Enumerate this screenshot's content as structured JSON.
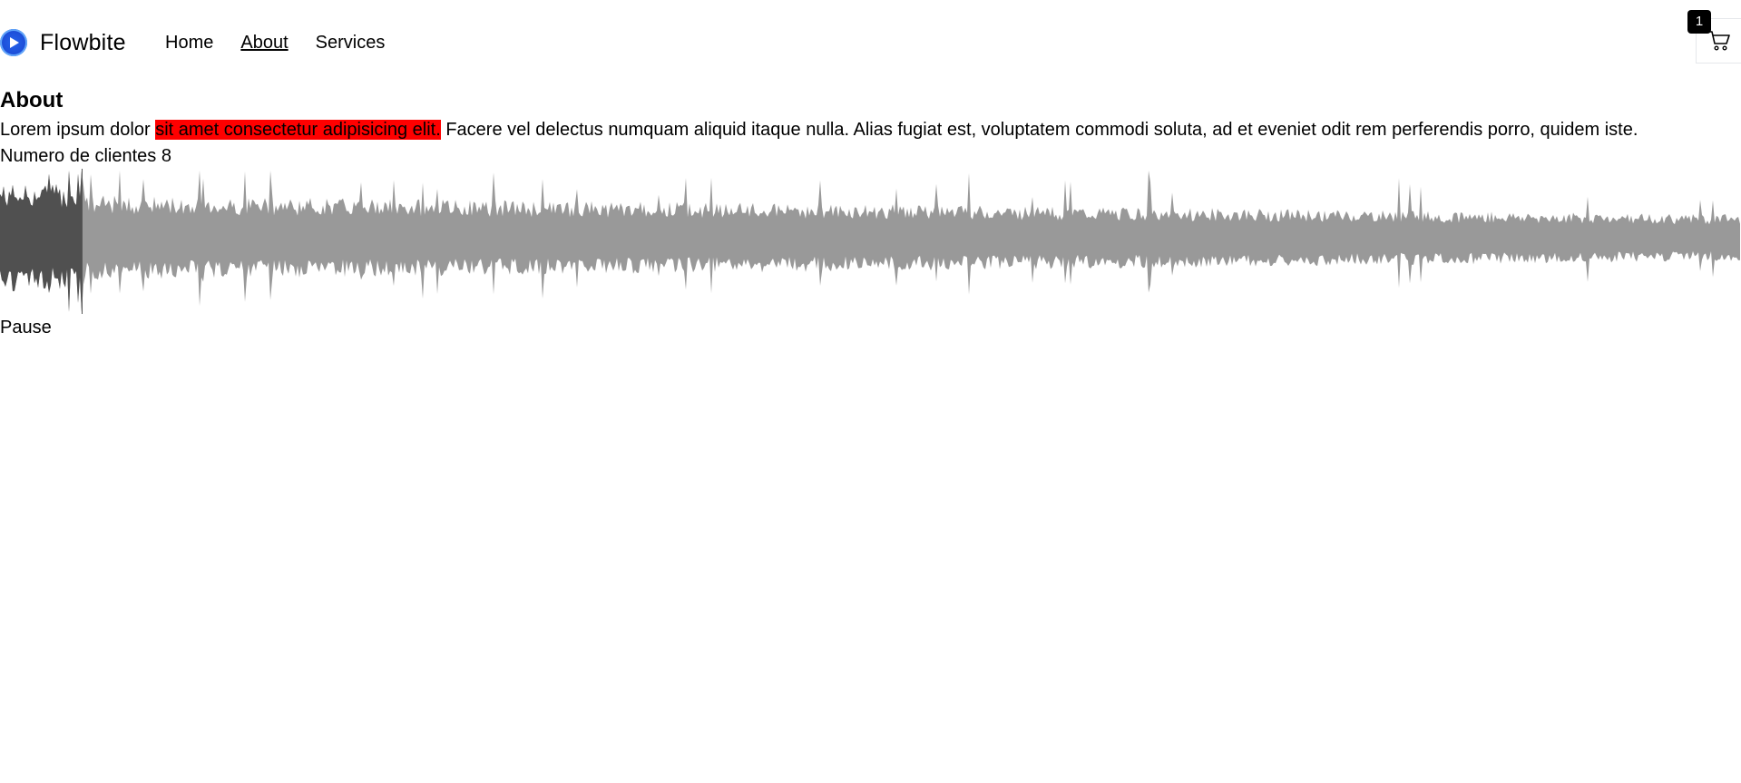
{
  "brand": {
    "name": "Flowbite",
    "logo_icon": "play-logo-icon",
    "accent": "#1d4ed8"
  },
  "nav": {
    "items": [
      {
        "label": "Home",
        "active": false
      },
      {
        "label": "About",
        "active": true
      },
      {
        "label": "Services",
        "active": false
      }
    ]
  },
  "cart": {
    "icon": "shopping-cart-icon",
    "count": "1"
  },
  "page": {
    "title": "About",
    "paragraph_before": "Lorem ipsum dolor ",
    "paragraph_highlight": "sit amet consectetur adipisicing elit.",
    "paragraph_after": " Facere vel delectus numquam aliquid itaque nulla. Alias fugiat est, voluptatem commodi soluta, ad et eveniet odit rem perferendis porro, quidem iste.",
    "highlight_color": "#ff0000",
    "clients_text": "Numero de clientes 8"
  },
  "player": {
    "progress": 0.047,
    "played_color": "#505050",
    "unplayed_color": "#999999",
    "button_label": "Pause"
  }
}
